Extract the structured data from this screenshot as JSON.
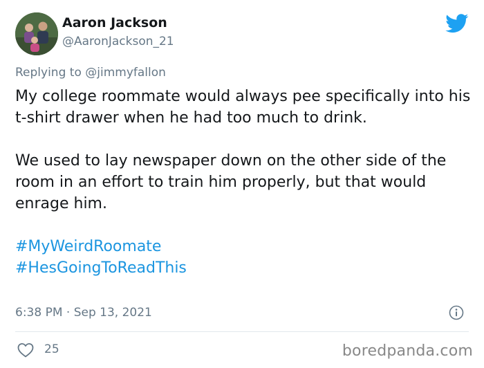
{
  "tweet": {
    "author_name": "Aaron Jackson",
    "author_handle": "@AaronJackson_21",
    "reply_prefix": "Replying to",
    "reply_to": "@jimmyfallon",
    "paragraph_1": "My college roommate would always pee specifically into his t-shirt drawer when he had too much to drink.",
    "paragraph_2": "We used to lay newspaper down on the other side of the room in an effort to train him properly, but that would enrage him.",
    "hashtags": [
      "#MyWeirdRoomate",
      "#HesGoingToReadThis"
    ],
    "timestamp": "6:38 PM · Sep 13, 2021",
    "like_count": "25"
  },
  "watermark": "boredpanda.com",
  "icons": {
    "brand": "twitter-bird-icon",
    "info": "info-icon",
    "like": "heart-icon"
  },
  "colors": {
    "twitter_blue": "#1da1f2",
    "hashtag": "#1b95e0",
    "muted_text": "#657786",
    "text": "#14171a"
  }
}
